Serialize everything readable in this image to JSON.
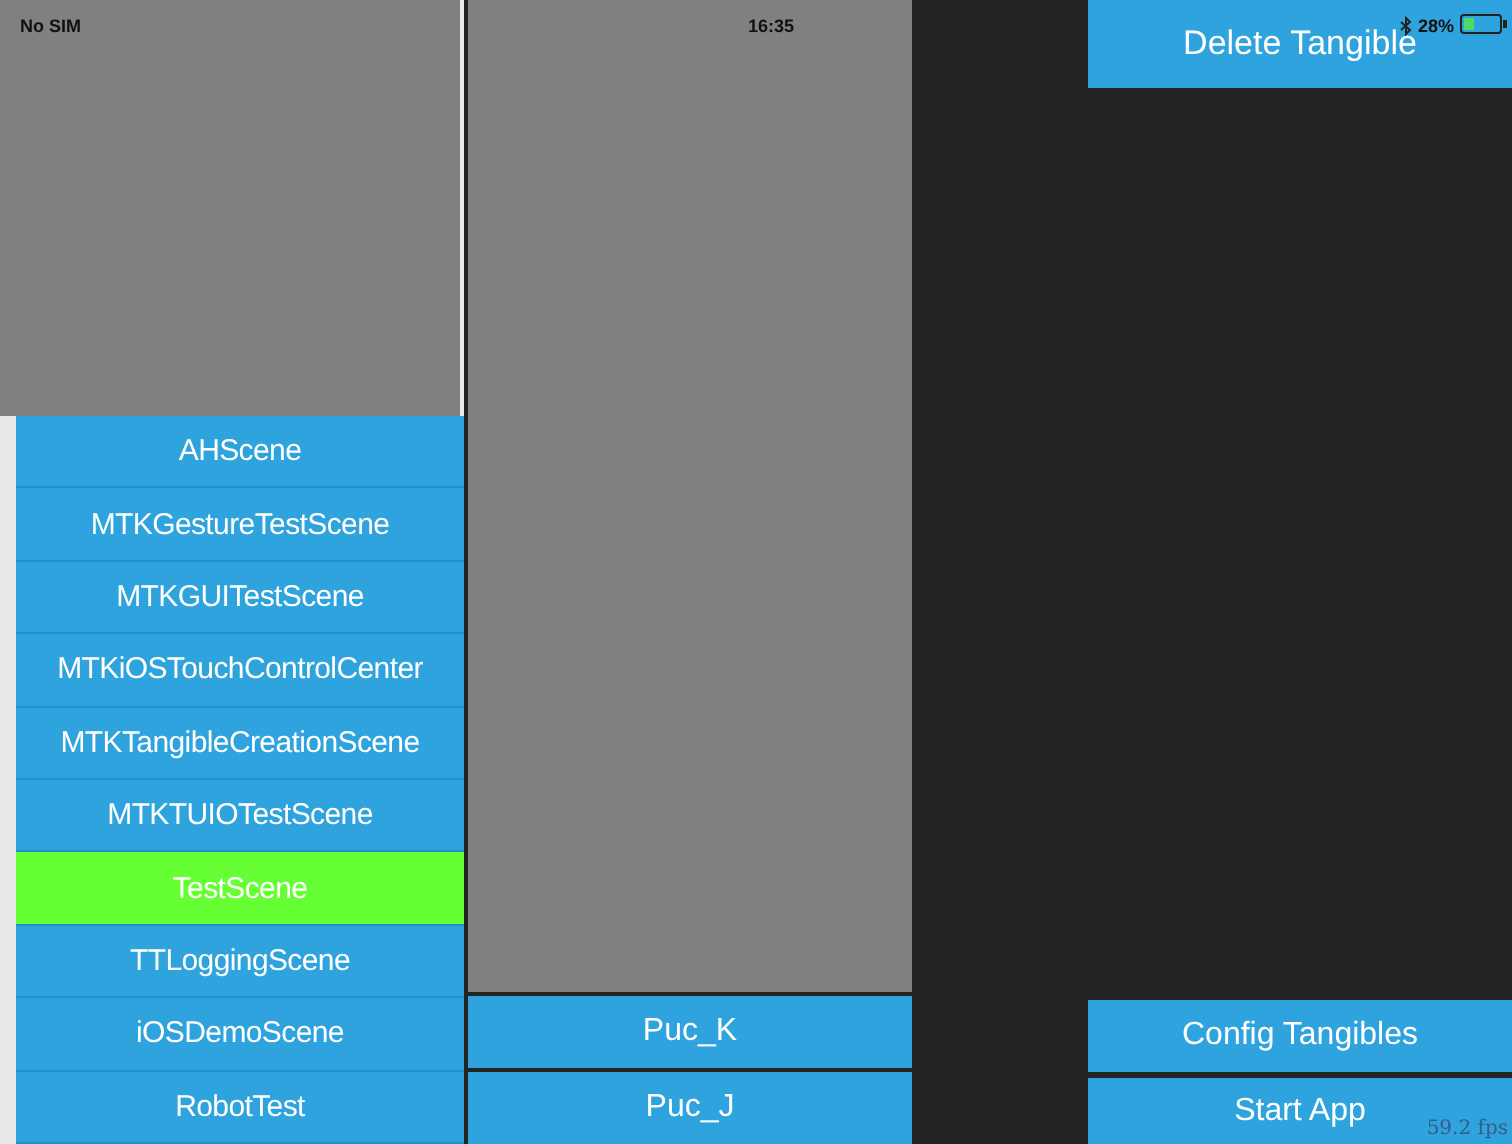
{
  "status_bar": {
    "carrier": "No SIM",
    "time": "16:35",
    "battery": "28%"
  },
  "scenes": [
    {
      "label": "AHScene",
      "selected": false
    },
    {
      "label": "MTKGestureTestScene",
      "selected": false
    },
    {
      "label": "MTKGUITestScene",
      "selected": false
    },
    {
      "label": "MTKiOSTouchControlCenter",
      "selected": false
    },
    {
      "label": "MTKTangibleCreationScene",
      "selected": false
    },
    {
      "label": "MTKTUIOTestScene",
      "selected": false
    },
    {
      "label": "TestScene",
      "selected": true
    },
    {
      "label": "TTLoggingScene",
      "selected": false
    },
    {
      "label": "iOSDemoScene",
      "selected": false
    },
    {
      "label": "RobotTest",
      "selected": false
    }
  ],
  "tangibles": [
    "Puc_K",
    "Puc_J"
  ],
  "actions": {
    "delete": "Delete Tangible",
    "config": "Config Tangibles",
    "start": "Start App"
  },
  "fps": "59.2 fps"
}
